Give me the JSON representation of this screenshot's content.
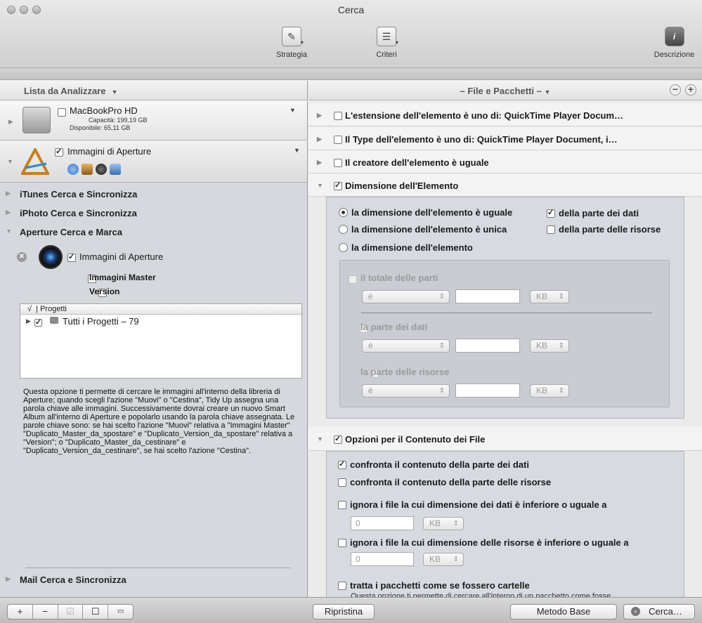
{
  "window": {
    "title": "Cerca"
  },
  "toolbar": {
    "strategy": "Strategia",
    "criteria": "Criteri",
    "description": "Descrizione"
  },
  "left": {
    "header": "Lista da Analizzare",
    "device1": {
      "name": "MacBookPro HD",
      "capacity": "Capacità: 199,19 GB",
      "available": "Disponibile: 65,11 GB"
    },
    "device2": {
      "name": "Immagini di Aperture"
    },
    "sections": {
      "itunes": "iTunes Cerca e Sincronizza",
      "iphoto": "iPhoto Cerca e Sincronizza",
      "aperture": "Aperture Cerca e Marca",
      "mail": "Mail Cerca e Sincronizza"
    },
    "aperture_item": "Immagini di Aperture",
    "master": "Immagini Master",
    "version": "Version",
    "projects_header": "Progetti",
    "projects_check_header": "√",
    "project_row": "Tutti i Progetti – 79",
    "description": "Questa opzione ti permette di cercare le immagini all'interno della libreria di Aperture; quando scegli l'azione \"Muovi\" o \"Cestina\", Tidy Up assegna una parola chiave alle immagini. Successivamente dovrai creare un nuovo Smart Album all'interno di Aperture e popolarlo usando la parola chiave assegnata. Le parole chiave sono: se hai scelto l'azione \"Muovi\" relativa a \"Immagini Master\" \"Duplicato_Master_da_spostare\" e \"Duplicato_Version_da_spostare\" relativa a \"Version\"; o \"Duplicato_Master_da_cestinare\" e \"Duplicato_Version_da_cestinare\", se hai scelto l'azione \"Cestina\"."
  },
  "right": {
    "header": "– File e Pacchetti –",
    "rows": {
      "ext": "L'estensione dell'elemento è uno di: QuickTime Player Docum…",
      "type": "Il Type dell'elemento è uno di: QuickTime Player Document, i…",
      "creator": "Il creatore dell'elemento è uguale",
      "size": "Dimensione dell'Elemento",
      "content": "Opzioni per il Contenuto dei File"
    },
    "size_opts": {
      "equal": "la dimensione dell'elemento è uguale",
      "unique": "la dimensione dell'elemento è unica",
      "plain": "la dimensione dell'elemento",
      "data_part": "della parte dei dati",
      "res_part": "della parte delle risorse"
    },
    "inner": {
      "total": "il totale delle parti",
      "data": "la parte dei dati",
      "res": "la parte delle risorse",
      "op": "è",
      "unit": "KB"
    },
    "content_opts": {
      "cmp_data": "confronta il contenuto della parte dei dati",
      "cmp_res": "confronta il contenuto della parte delle risorse",
      "ign_data": "ignora i file la cui dimensione dei dati è inferiore o uguale a",
      "ign_res": "ignora i file la cui dimensione delle risorse è inferiore o uguale a",
      "zero": "0",
      "unit": "KB",
      "pkg": "tratta i pacchetti come se fossero cartelle",
      "pkg_note": "Questa opzione ti permette di cercare all'interno di un pacchetto come fosse"
    }
  },
  "bottom": {
    "reset": "Ripristina",
    "base": "Metodo Base",
    "search": "Cerca…"
  }
}
